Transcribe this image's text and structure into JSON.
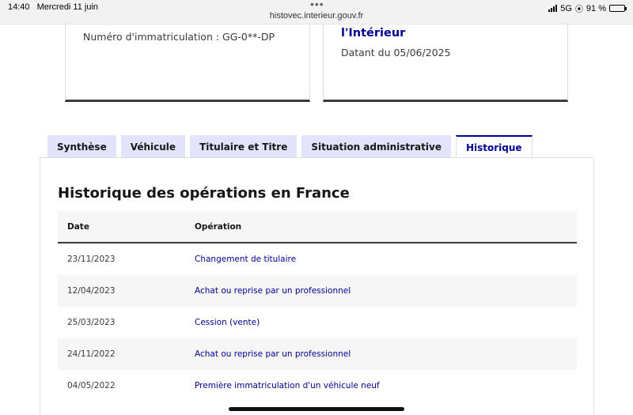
{
  "status_bar": {
    "time": "14:40",
    "date": "Mercredi 11 juin",
    "url": "histovec.interieur.gouv.fr",
    "network": "5G",
    "battery": "91 %",
    "battery_level": 0.91,
    "icons": [
      "signal-icon",
      "location-icon",
      "battery-icon"
    ]
  },
  "cards": {
    "left": {
      "registration": "Numéro d'immatriculation : GG-0**-DP"
    },
    "right": {
      "authority": "l'Intérieur",
      "date": "Datant du 05/06/2025"
    }
  },
  "tabs": [
    {
      "label": "Synthèse",
      "active": false
    },
    {
      "label": "Véhicule",
      "active": false
    },
    {
      "label": "Titulaire et Titre",
      "active": false
    },
    {
      "label": "Situation administrative",
      "active": false
    },
    {
      "label": "Historique",
      "active": true
    }
  ],
  "history": {
    "title": "Historique des opérations en France",
    "columns": [
      "Date",
      "Opération"
    ],
    "rows": [
      {
        "date": "23/11/2023",
        "operation": "Changement de titulaire"
      },
      {
        "date": "12/04/2023",
        "operation": "Achat ou reprise par un professionnel"
      },
      {
        "date": "25/03/2023",
        "operation": "Cession (vente)"
      },
      {
        "date": "24/11/2022",
        "operation": "Achat ou reprise par un professionnel"
      },
      {
        "date": "04/05/2022",
        "operation": "Première immatriculation d'un véhicule neuf"
      }
    ]
  },
  "colors": {
    "accent": "#000091",
    "tab_bg": "#e3e3fd",
    "row_alt": "#f6f6f6",
    "border_dark": "#3a3a3a"
  }
}
